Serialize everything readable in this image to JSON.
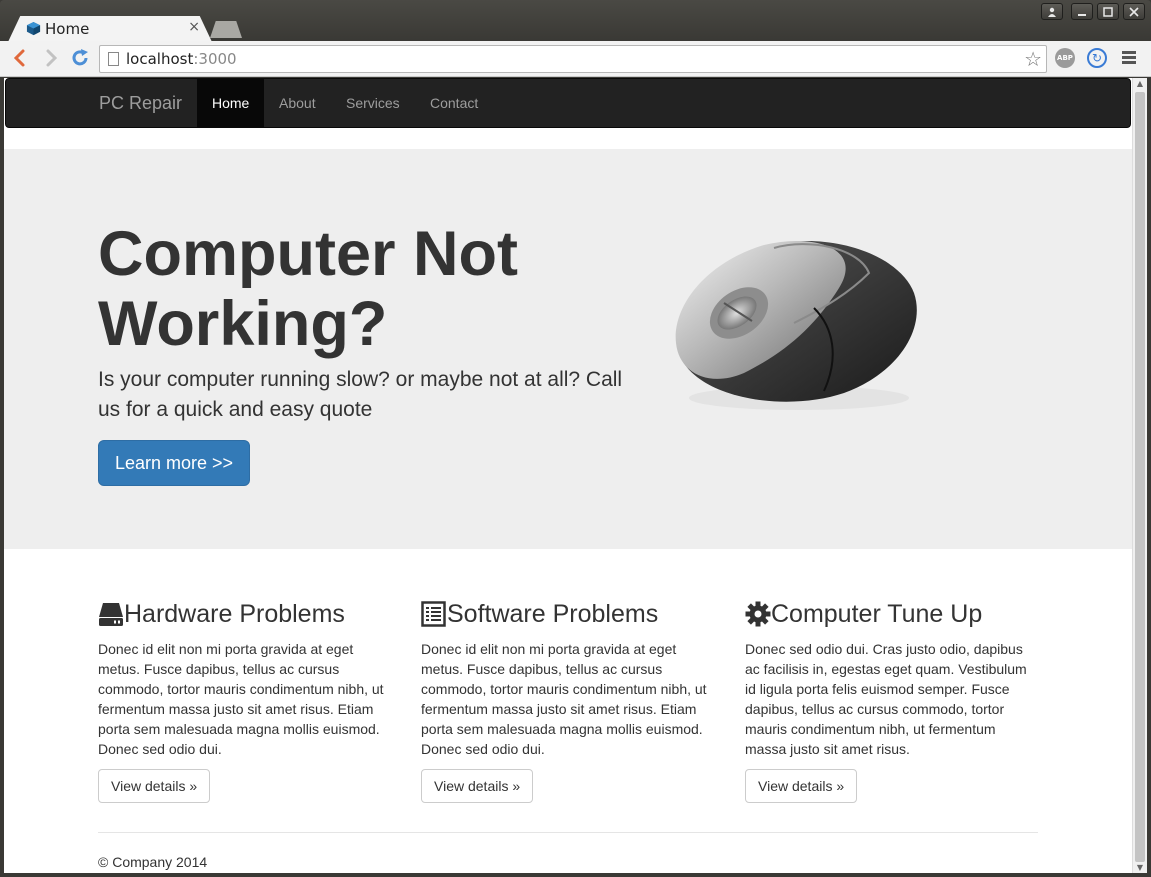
{
  "browser": {
    "tab_title": "Home",
    "tab_close": "×",
    "url_host": "localhost",
    "url_port": ":3000",
    "ext_abp": "ABP"
  },
  "navbar": {
    "brand": "PC Repair",
    "links": [
      {
        "label": "Home",
        "active": true
      },
      {
        "label": "About",
        "active": false
      },
      {
        "label": "Services",
        "active": false
      },
      {
        "label": "Contact",
        "active": false
      }
    ]
  },
  "jumbotron": {
    "title": "Computer Not Working?",
    "lead": "Is your computer running slow? or maybe not at all? Call us for a quick and easy quote",
    "button": "Learn more >>",
    "image_icon": "computer-mouse"
  },
  "columns": [
    {
      "icon": "hard-drive-icon",
      "title": "Hardware Problems",
      "text": "Donec id elit non mi porta gravida at eget metus. Fusce dapibus, tellus ac cursus commodo, tortor mauris condimentum nibh, ut fermentum massa justo sit amet risus. Etiam porta sem malesuada magna mollis euismod. Donec sed odio dui.",
      "button": "View details »"
    },
    {
      "icon": "list-alt-icon",
      "title": "Software Problems",
      "text": "Donec id elit non mi porta gravida at eget metus. Fusce dapibus, tellus ac cursus commodo, tortor mauris condimentum nibh, ut fermentum massa justo sit amet risus. Etiam porta sem malesuada magna mollis euismod. Donec sed odio dui.",
      "button": "View details »"
    },
    {
      "icon": "cog-icon",
      "title": "Computer Tune Up",
      "text": "Donec sed odio dui. Cras justo odio, dapibus ac facilisis in, egestas eget quam. Vestibulum id ligula porta felis euismod semper. Fusce dapibus, tellus ac cursus commodo, tortor mauris condimentum nibh, ut fermentum massa justo sit amet risus.",
      "button": "View details »"
    }
  ],
  "footer": {
    "text": "© Company 2014"
  },
  "colors": {
    "navbar_bg": "#222222",
    "jumbotron_bg": "#eeeeee",
    "primary": "#337ab7",
    "text": "#333333"
  }
}
